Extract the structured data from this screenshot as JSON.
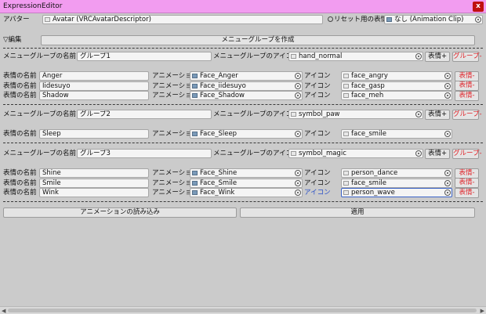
{
  "window": {
    "title": "ExpressionEditor",
    "close_label": "x"
  },
  "avatar_row": {
    "avatar_label": "アバター",
    "avatar_value": "Avatar (VRCAvatarDescriptor)",
    "reset_label": "リセット用の表情",
    "reset_value": "なし (Animation Clip)"
  },
  "edit_toggle": "▽編集",
  "create_menu_button": "メニューグループを作成",
  "labels": {
    "group_name": "メニューグループの名前",
    "group_icon": "メニューグループのアイコン",
    "add_expression": "表情+",
    "remove_group": "グループ-",
    "expression_name": "表情の名前",
    "animation": "アニメーション",
    "icon": "アイコン",
    "remove_expression": "表情-"
  },
  "groups": [
    {
      "name": "グループ1",
      "icon": "hand_normal",
      "expressions": [
        {
          "name": "Anger",
          "animation": "Face_Anger",
          "icon": "face_angry"
        },
        {
          "name": "Iidesuyo",
          "animation": "Face_iidesuyo",
          "icon": "face_gasp"
        },
        {
          "name": "Shadow",
          "animation": "Face_Shadow",
          "icon": "face_meh"
        }
      ]
    },
    {
      "name": "グループ2",
      "icon": "symbol_paw",
      "expressions": [
        {
          "name": "Sleep",
          "animation": "Face_Sleep",
          "icon": "face_smile"
        }
      ]
    },
    {
      "name": "グループ3",
      "icon": "symbol_magic",
      "expressions": [
        {
          "name": "Shine",
          "animation": "Face_Shine",
          "icon": "person_dance"
        },
        {
          "name": "Smile",
          "animation": "Face_Smile",
          "icon": "face_smile"
        },
        {
          "name": "Wink",
          "animation": "Face_Wink",
          "icon": "person_wave"
        }
      ]
    }
  ],
  "footer": {
    "load_animations_button": "アニメーションの読み込み",
    "apply_button": "適用"
  }
}
